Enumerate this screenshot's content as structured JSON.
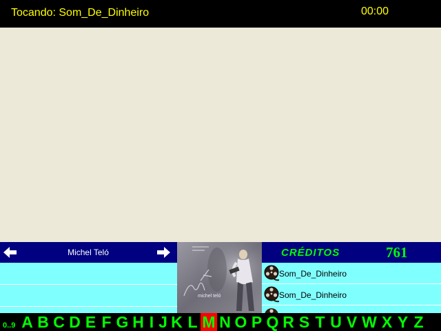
{
  "header": {
    "now_playing": "Tocando: Som_De_Dinheiro",
    "clock": "00:00"
  },
  "artist_nav": {
    "artist_name": "Michel Teló",
    "prev_icon": "arrow-left-icon",
    "next_icon": "arrow-right-icon"
  },
  "album": {
    "cover_text": "michel teló",
    "cover_monogram": "mt"
  },
  "credits": {
    "label": "CRÉDITOS",
    "value": "761"
  },
  "queue": {
    "icon": "film-reel-icon",
    "items": [
      {
        "title": "Som_De_Dinheiro"
      },
      {
        "title": "Som_De_Dinheiro"
      }
    ]
  },
  "letter_bar": {
    "digits_label": "0..9",
    "letters": [
      "A",
      "B",
      "C",
      "D",
      "E",
      "F",
      "G",
      "H",
      "I",
      "J",
      "K",
      "L",
      "M",
      "N",
      "O",
      "P",
      "Q",
      "R",
      "S",
      "T",
      "U",
      "V",
      "W",
      "X",
      "Y",
      "Z"
    ],
    "selected": "M"
  },
  "colors": {
    "header_bg": "#000000",
    "header_text": "#ffff00",
    "panel_bg": "#000080",
    "list_bg": "#80ffff",
    "credits_text": "#00ff00",
    "letter_text": "#00ff00",
    "selected_letter_bg": "#ff0000",
    "video_bg": "#ece9d9"
  }
}
